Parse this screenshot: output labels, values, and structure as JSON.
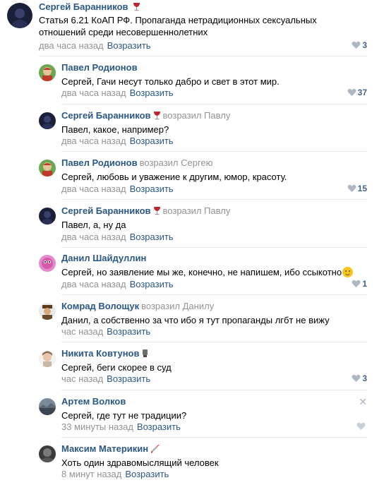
{
  "comments": [
    {
      "author": "Сергей Баранников",
      "reply_to": "",
      "text": "Статья 6.21 КоАП РФ. Пропаганда нетрадиционных сексуальных",
      "text2": "отношений среди несовершеннолетних",
      "time": "два часа назад",
      "reply_label": "Возразить",
      "likes": "3"
    },
    {
      "author": "Павел Родионов",
      "reply_to": "",
      "text": "Сергей, Гачи несут только дабро и свет в этот мир.",
      "time": "два часа назад",
      "reply_label": "Возразить",
      "likes": "37"
    },
    {
      "author": "Сергей Баранников",
      "reply_to": "возразил Павлу",
      "text": "Павел, какое, например?",
      "time": "два часа назад",
      "reply_label": "Возразить",
      "likes": ""
    },
    {
      "author": "Павел Родионов",
      "reply_to": "возразил Сергею",
      "text": "Сергей, любовь и уважение к другим, юмор, красоту.",
      "time": "два часа назад",
      "reply_label": "Возразить",
      "likes": "15"
    },
    {
      "author": "Сергей Баранников",
      "reply_to": "возразил Павлу",
      "text": "Павел, а, ну да",
      "time": "два часа назад",
      "reply_label": "Возразить",
      "likes": ""
    },
    {
      "author": "Данил Шайдуллин",
      "reply_to": "",
      "text": "Сергей, но заявление мы же, конечно, не напишем, ибо ссыкотно",
      "time": "два часа назад",
      "reply_label": "Возразить",
      "likes": "1"
    },
    {
      "author": "Комрад Волощук",
      "reply_to": "возразил Данилу",
      "text": "Данил, а собственно за что ибо я тут пропаганды лгбт не вижу",
      "time": "час назад",
      "reply_label": "Возразить",
      "likes": ""
    },
    {
      "author": "Никита Ковтунов",
      "reply_to": "",
      "text": "Сергей, беги скорее в суд",
      "time": "час назад",
      "reply_label": "Возразить",
      "likes": "3"
    },
    {
      "author": "Артем Волков",
      "reply_to": "",
      "text": "Сергей, где тут не традиции?",
      "time": "33 минуты назад",
      "reply_label": "Возразить",
      "likes": ""
    },
    {
      "author": "Максим Материкин",
      "reply_to": "",
      "text": "Хоть один здравомыслящий человек",
      "time": "8 минут назад",
      "reply_label": "Возразить",
      "likes": ""
    }
  ],
  "icons": {
    "like": "heart-icon",
    "close": "close-icon",
    "emoji_wine": "wine-glass-emoji",
    "emoji_smile": "smile-emoji"
  },
  "colors": {
    "link": "#2a5885",
    "muted": "#939393",
    "separator": "#e7e8ec"
  }
}
